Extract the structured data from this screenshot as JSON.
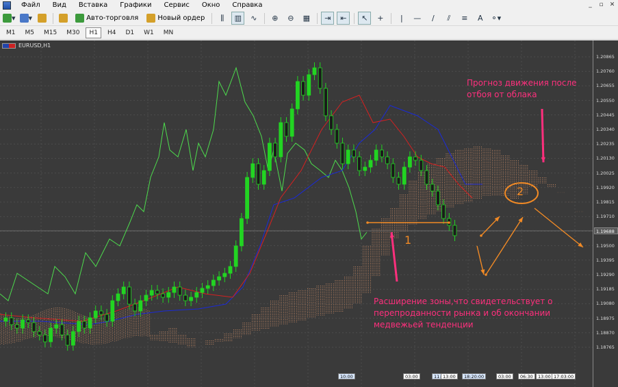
{
  "menu": [
    "Файл",
    "Вид",
    "Вставка",
    "Графики",
    "Сервис",
    "Окно",
    "Справка"
  ],
  "toolbar": {
    "autotrade_label": "Авто-торговля",
    "neworder_label": "Новый ордер"
  },
  "timeframes": [
    "M1",
    "M5",
    "M15",
    "M30",
    "H1",
    "H4",
    "D1",
    "W1",
    "MN"
  ],
  "active_timeframe": "H1",
  "chart": {
    "symbol_label": "EURUSD,H1",
    "price_levels": [
      "1.20865",
      "1.20760",
      "1.20655",
      "1.20550",
      "1.20445",
      "1.20340",
      "1.20235",
      "1.20130",
      "1.20025",
      "1.19920",
      "1.19815",
      "1.19710",
      "1.19605",
      "1.19500",
      "1.19395",
      "1.19290",
      "1.19185",
      "1.19080",
      "1.18975",
      "1.18870",
      "1.18765"
    ],
    "current_price": "1.19688",
    "time_tags": [
      "10:00",
      "03:00",
      "11:13",
      "13:00",
      "18:20:00",
      "03:00",
      "06:30",
      "13:00",
      "17:03:00"
    ],
    "annotations": {
      "forecast": "Прогноз движения после отбоя от облака",
      "expansion": "Расширение зоны,что свидетельствует о перепроданности рынка и об окончании медвежьей тенденции",
      "label_1": "1",
      "label_2": "2"
    },
    "colors": {
      "bg": "#3a3a3a",
      "bull": "#22d422",
      "bear": "#22d422",
      "chikou": "#4ddc4d",
      "tenkan": "#d82020",
      "kijun": "#1a2ad8",
      "cloud": "#f0a070",
      "annot": "#ff2f7d",
      "arrows": "#f18a25"
    }
  }
}
